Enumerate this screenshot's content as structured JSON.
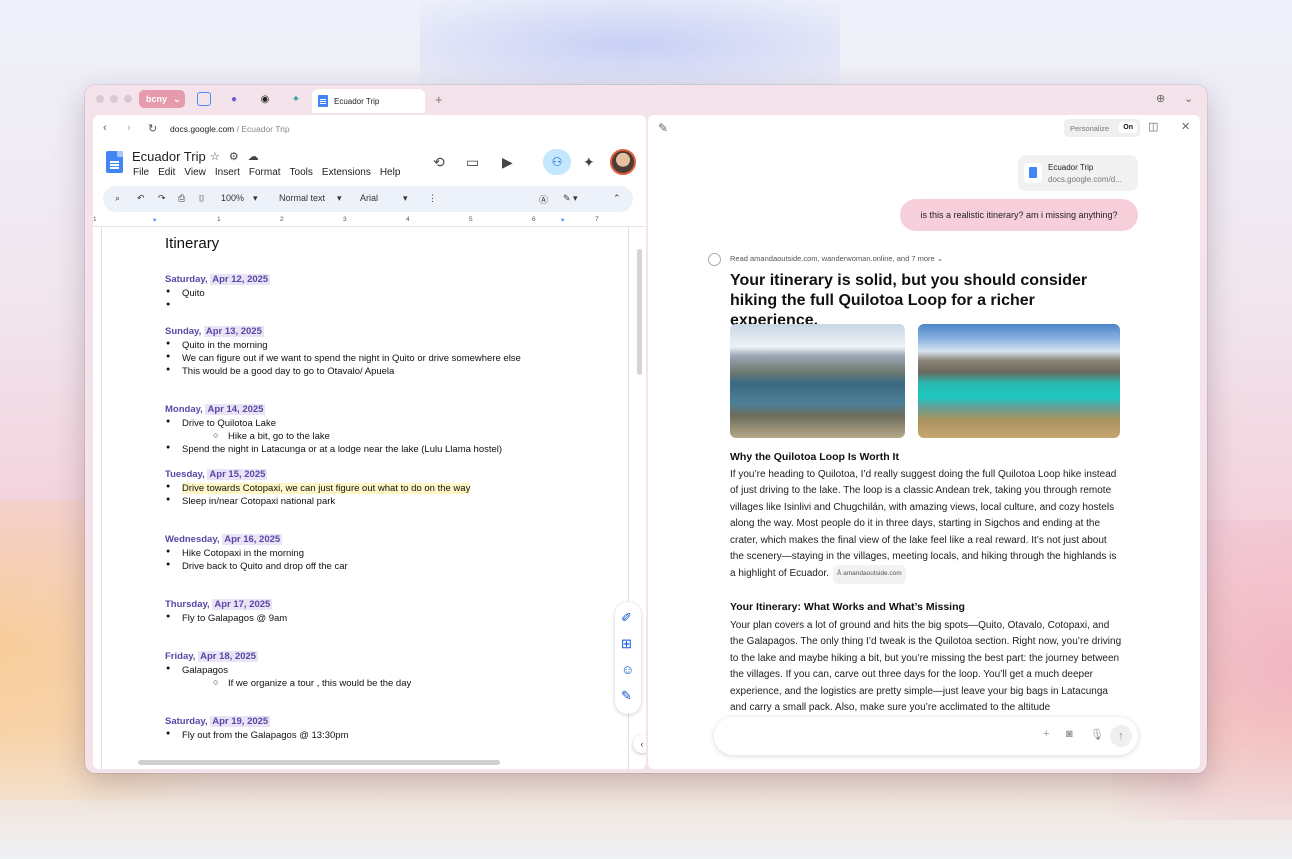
{
  "browser": {
    "profile": "bcny",
    "active_tab": "Ecuador Trip",
    "url_domain": "docs.google.com",
    "url_path": " / Ecuador Trip"
  },
  "docs": {
    "title": "Ecuador Trip",
    "menus": [
      "File",
      "Edit",
      "View",
      "Insert",
      "Format",
      "Tools",
      "Extensions",
      "Help"
    ],
    "zoom": "100%",
    "style": "Normal text",
    "font": "Arial",
    "ruler": [
      "1",
      "1",
      "2",
      "3",
      "4",
      "5",
      "6",
      "7"
    ],
    "heading": "Itinerary",
    "days": [
      {
        "day": "Saturday,",
        "date": "Apr 12, 2025",
        "items": [
          "Quito",
          ""
        ]
      },
      {
        "day": "Sunday,",
        "date": "Apr 13, 2025",
        "items": [
          "Quito in the morning",
          "We can figure out if we want to spend the night in Quito or drive somewhere else",
          "This would be a good day to go to Otavalo/ Apuela"
        ]
      },
      {
        "day": "Monday,",
        "date": "Apr 14, 2025",
        "items": [
          "Drive to Quilotoa Lake",
          "Hike a bit, go to the lake",
          "Spend the night in Latacunga or at a lodge near the lake (Lulu Llama hostel)"
        ]
      },
      {
        "day": "Tuesday,",
        "date": "Apr 15, 2025",
        "items": [
          "Drive towards Cotopaxi, we can just figure out what to do on the way",
          "Sleep in/near Cotopaxi national park"
        ]
      },
      {
        "day": "Wednesday,",
        "date": "Apr 16, 2025",
        "items": [
          "Hike Cotopaxi in the morning",
          "Drive back to Quito and drop off the car"
        ]
      },
      {
        "day": "Thursday,",
        "date": "Apr 17, 2025",
        "items": [
          "Fly to Galapagos @ 9am"
        ]
      },
      {
        "day": "Friday,",
        "date": "Apr 18, 2025",
        "items": [
          "Galapagos",
          "If we organize a tour , this would be the day"
        ]
      },
      {
        "day": "Saturday,",
        "date": "Apr 19, 2025",
        "items": [
          "Fly out from the Galapagos @ 13:30pm"
        ]
      }
    ]
  },
  "assistant": {
    "personalize": "Personalize",
    "personalize_state": "On",
    "chip_title": "Ecuador Trip",
    "chip_url": "docs.google.com/d...",
    "user_message": "is this a realistic itinerary? am i missing anything?",
    "sources": "Read amandaoutside.com, wanderwoman.online, and 7 more",
    "headline": "Your itinerary is solid, but you should consider hiking the full Quilotoa Loop for a richer experience.",
    "section1_title": "Why the Quilotoa Loop Is Worth It",
    "section1_body": "If you’re heading to Quilotoa, I’d really suggest doing the full Quilotoa Loop hike instead of just driving to the lake. The loop is a classic Andean trek, taking you through remote villages like Isinlivi and Chugchilán, with amazing views, local culture, and cozy hostels along the way. Most people do it in three days, starting in Sigchos and ending at the crater, which makes the final view of the lake feel like a real reward. It’s not just about the scenery—staying in the villages, meeting locals, and hiking through the highlands is a highlight of Ecuador.",
    "section1_source": "amandaoutside.com",
    "section2_title": "Your Itinerary: What Works and What’s Missing",
    "section2_body": "Your plan covers a lot of ground and hits the big spots—Quito, Otavalo, Cotopaxi, and the Galapagos. The only thing I’d tweak is the Quilotoa section. Right now, you’re driving to the lake and maybe hiking a bit, but you’re missing the best part: the journey between the villages. If you can, carve out three days for the loop. You’ll get a much deeper experience, and the logistics are pretty simple—just leave your big bags in Latacunga and carry a small pack. Also, make sure you’re acclimated to the altitude",
    "input_placeholder": ""
  }
}
